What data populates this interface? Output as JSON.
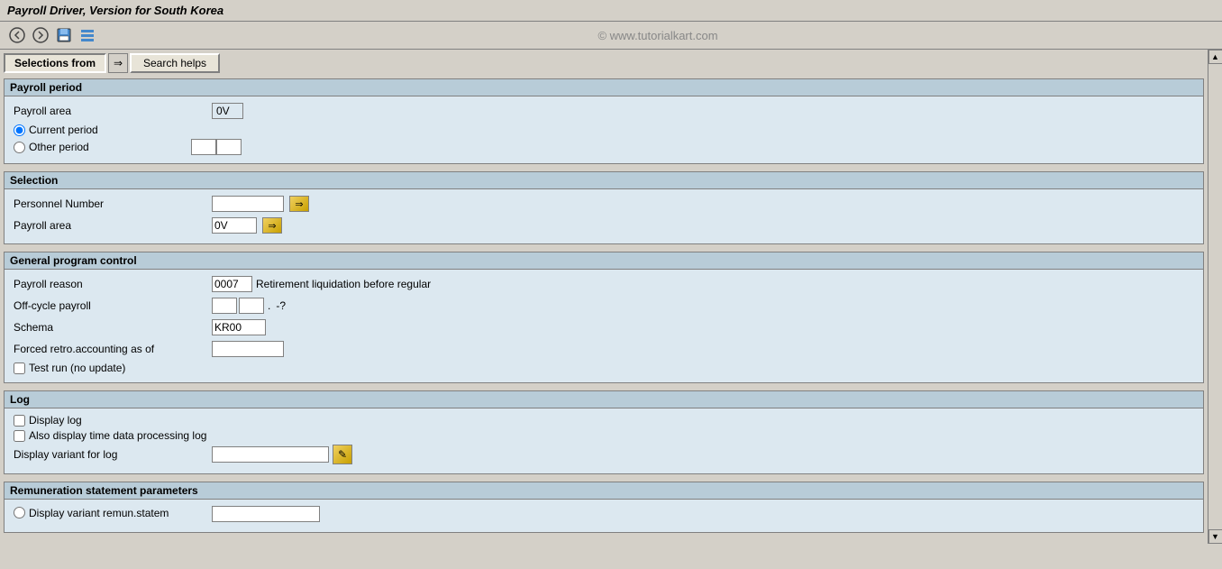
{
  "titleBar": {
    "text": "Payroll Driver, Version for South Korea"
  },
  "toolbar": {
    "watermark": "© www.tutorialkart.com",
    "icons": [
      "back-icon",
      "forward-icon",
      "save-icon",
      "layout-icon"
    ]
  },
  "topButtons": {
    "selections_label": "Selections from",
    "arrow_label": "⇒",
    "search_label": "Search helps"
  },
  "payrollPeriod": {
    "sectionTitle": "Payroll period",
    "payrollAreaLabel": "Payroll area",
    "payrollAreaValue": "0V",
    "currentPeriodLabel": "Current period",
    "otherPeriodLabel": "Other period",
    "otherPeriodVal1": "",
    "otherPeriodVal2": ""
  },
  "selection": {
    "sectionTitle": "Selection",
    "personnelNumberLabel": "Personnel Number",
    "personnelNumberValue": "",
    "payrollAreaLabel": "Payroll area",
    "payrollAreaValue": "0V"
  },
  "generalProgramControl": {
    "sectionTitle": "General program control",
    "payrollReasonLabel": "Payroll reason",
    "payrollReasonCode": "0007",
    "payrollReasonText": "Retirement liquidation before regular",
    "offCyclePayrollLabel": "Off-cycle payroll",
    "offCycleVal1": "",
    "offCycleDot": ".",
    "offCycleVal2": "-?",
    "schemaLabel": "Schema",
    "schemaValue": "KR00",
    "forcedRetroLabel": "Forced retro.accounting as of",
    "forcedRetroValue": "",
    "testRunLabel": "Test run (no update)"
  },
  "log": {
    "sectionTitle": "Log",
    "displayLogLabel": "Display log",
    "alsoDisplayLabel": "Also display time data processing log",
    "displayVariantLabel": "Display variant for log",
    "displayVariantValue": "",
    "pencilIcon": "✎"
  },
  "remunerationStatement": {
    "sectionTitle": "Remuneration statement parameters",
    "displayVariantLabel": "Display variant remun.statem",
    "displayVariantValue": ""
  }
}
